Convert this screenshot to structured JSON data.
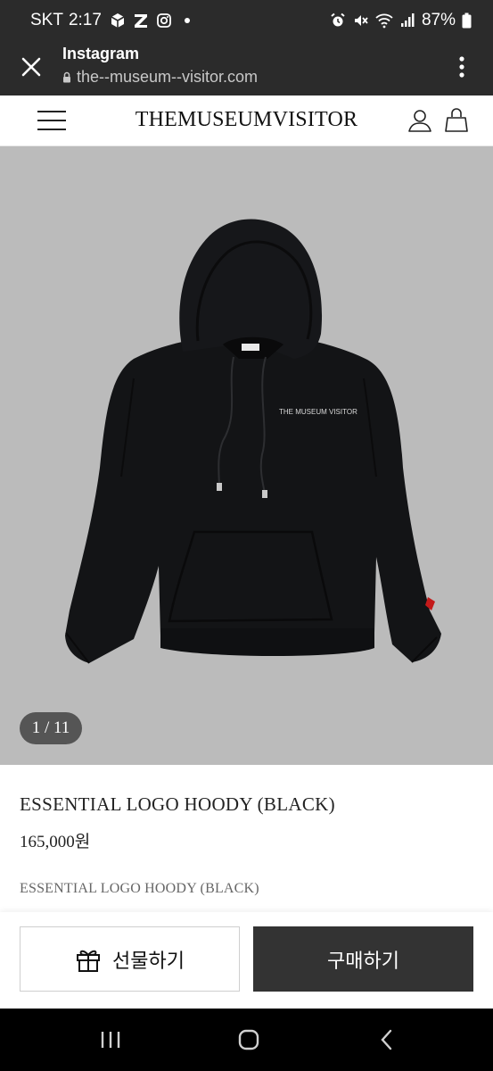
{
  "status_bar": {
    "carrier": "SKT",
    "time": "2:17",
    "battery": "87%",
    "left_icons": [
      "box-app-icon",
      "z-app-icon",
      "instagram-icon",
      "dot-icon"
    ],
    "right_icons": [
      "alarm-icon",
      "mute-icon",
      "wifi-icon",
      "signal-icon",
      "battery-icon"
    ]
  },
  "browser": {
    "title": "Instagram",
    "url": "the--museum--visitor.com"
  },
  "site": {
    "brand": "THEMUSEUMVISITOR"
  },
  "gallery": {
    "counter": "1 / 11",
    "print_text": "THE MUSEUM VISITOR"
  },
  "product": {
    "name": "ESSENTIAL LOGO HOODY (BLACK)",
    "price": "165,000원",
    "description": "ESSENTIAL LOGO HOODY (BLACK)"
  },
  "actions": {
    "gift_label": "선물하기",
    "buy_label": "구매하기"
  },
  "colors": {
    "system_bar": "#2b2b2b",
    "image_bg": "#bbbbbb",
    "buy_button": "#333333",
    "hoodie": "#131416"
  }
}
